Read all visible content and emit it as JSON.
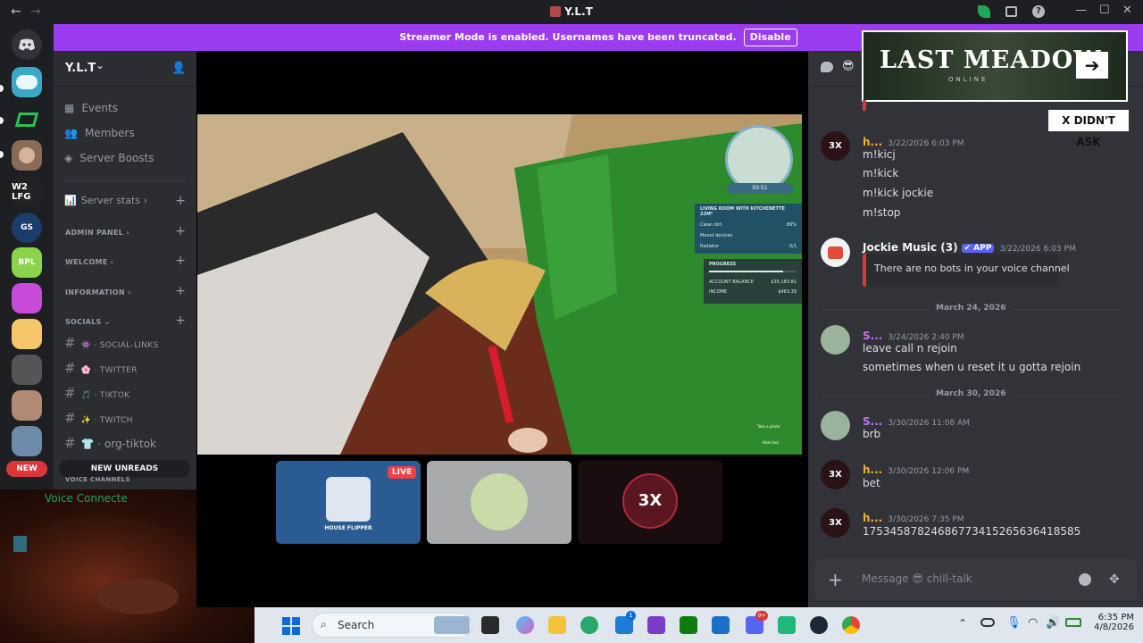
{
  "titlebar": {
    "title": "Y.L.T",
    "back": "←",
    "forward": "→",
    "minimize": "—",
    "maximize": "☐",
    "close": "✕",
    "help": "?"
  },
  "banner": {
    "text": "Streamer Mode is enabled. Usernames have been truncated.",
    "button": "Disable"
  },
  "rail": {
    "new_label": "NEW"
  },
  "server": {
    "name": "Y.L.T",
    "chevron": "⌄",
    "top_items": [
      "Events",
      "Members",
      "Server Boosts"
    ],
    "stats": "Server stats",
    "categories": [
      "ADMIN PANEL",
      "WELCOME",
      "INFORMATION",
      "SOCIALS"
    ],
    "channels": [
      "SOCIAL-LINKS",
      "TWITTER",
      "TIKTOK",
      "TWITCH",
      "org-tiktok"
    ],
    "channel_emoji": [
      "👾",
      "🌸",
      "🎵",
      "✨",
      "👕"
    ],
    "new_unreads": "NEW UNREADS",
    "voice_channels": "VOICE CHANNELS",
    "voice_connected": "Voice Connecte"
  },
  "game_hud": {
    "timer": "03:51",
    "room_title": "LIVING ROOM WITH KITCHENETTE 22M²",
    "tasks": [
      {
        "label": "Clean dirt",
        "value": "89%"
      },
      {
        "label": "Mount devices",
        "value": ""
      },
      {
        "label": "Radiator",
        "value": "0/1"
      }
    ],
    "progress_label": "PROGRESS",
    "progress": 0.85,
    "account_label": "ACCOUNT BALANCE",
    "account_value": "$35,183.81",
    "income_label": "INCOME",
    "income_value": "$463.39",
    "hint1": "Take a photo",
    "hint2": "Hide tool"
  },
  "tiles": {
    "live": "LIVE",
    "game_name": "HOUSE FLIPPER",
    "badge": "3X"
  },
  "ad": {
    "title": "LAST MEADOW",
    "subtitle": "ONLINE",
    "arrow": "➔",
    "dismiss": "X DIDN'T ASK"
  },
  "chat": {
    "messages": [
      {
        "author": "h...",
        "color": "#f0b232",
        "time": "3/22/2026 6:03 PM",
        "lines": [
          "m!kicj",
          "m!kick",
          "m!kick jockie",
          "m!stop"
        ]
      },
      {
        "author": "Jockie Music (3)",
        "color": "#f2f3f5",
        "app_tag": "✔ APP",
        "time": "3/22/2026 6:03 PM",
        "embed": "There are no bots in your voice channel"
      },
      {
        "date": "March 24, 2026"
      },
      {
        "author": "S...",
        "color": "#c86ff5",
        "time": "3/24/2026 2:40 PM",
        "lines": [
          "leave call n rejoin",
          "sometimes when u reset it u gotta rejoin"
        ]
      },
      {
        "date": "March 30, 2026"
      },
      {
        "author": "S...",
        "color": "#c86ff5",
        "time": "3/30/2026 11:08 AM",
        "lines": [
          "brb"
        ]
      },
      {
        "author": "h...",
        "color": "#f0b232",
        "time": "3/30/2026 12:06 PM",
        "lines": [
          "bet"
        ]
      },
      {
        "author": "h...",
        "color": "#f0b232",
        "time": "3/30/2026 7:35 PM",
        "lines": [
          "1753458782468677341526563641858​5"
        ]
      }
    ],
    "input_placeholder": "Message 😎 chill-talk",
    "plus": "+"
  },
  "taskbar": {
    "search": "Search",
    "time": "6:35 PM",
    "date": "4/8/2026",
    "badge": "1",
    "discord_badge": "9+"
  },
  "colors": {
    "banner": "#9b3cf1",
    "discord_bg": "#313338",
    "sidebar_bg": "#2b2d31",
    "new_badge": "#da373c",
    "live_badge": "#f23f43",
    "app_tag": "#5865f2"
  }
}
